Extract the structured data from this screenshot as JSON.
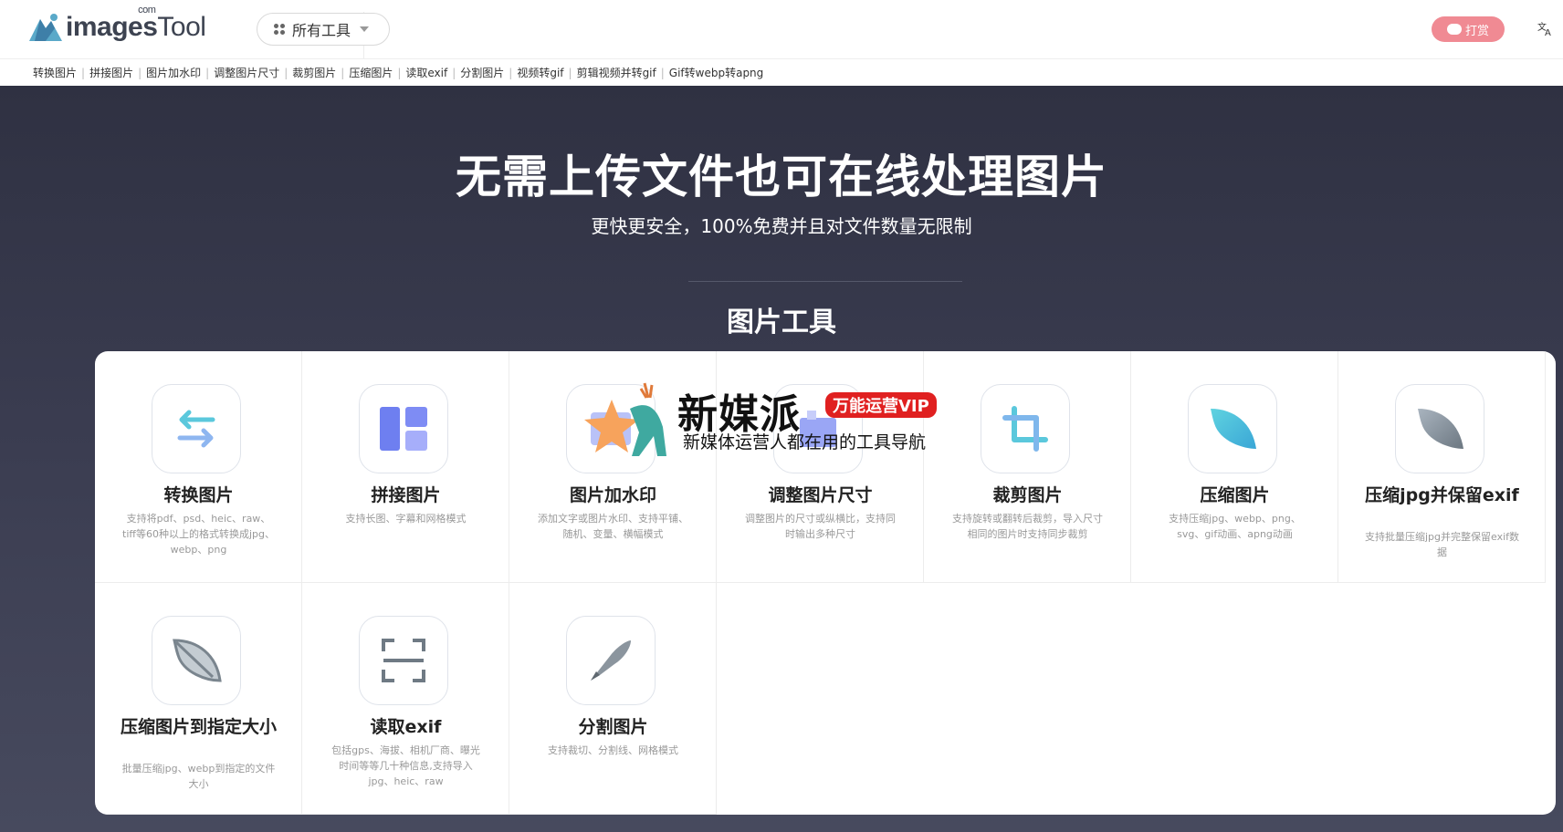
{
  "header": {
    "logo": {
      "main": "images",
      "tool": "Tool",
      "com": "com"
    },
    "tools_dropdown_label": "所有工具",
    "tip_button_label": "打赏",
    "language_icon": "translate-icon"
  },
  "subnav": {
    "items": [
      "转换图片",
      "拼接图片",
      "图片加水印",
      "调整图片尺寸",
      "裁剪图片",
      "压缩图片",
      "读取exif",
      "分割图片",
      "视频转gif",
      "剪辑视频并转gif",
      "Gif转webp转apng"
    ]
  },
  "hero": {
    "title": "无需上传文件也可在线处理图片",
    "subtitle": "更快更安全，100%免费并且对文件数量无限制",
    "section_title": "图片工具"
  },
  "tools": [
    {
      "name": "转换图片",
      "desc": "支持将pdf、psd、heic、raw、tiff等60种以上的格式转换成jpg、webp、png",
      "icon": "convert-arrows-icon"
    },
    {
      "name": "拼接图片",
      "desc": "支持长图、字幕和网格模式",
      "icon": "collage-icon"
    },
    {
      "name": "图片加水印",
      "desc": "添加文字或图片水印、支持平铺、随机、变量、横幅模式",
      "icon": "watermark-icon"
    },
    {
      "name": "调整图片尺寸",
      "desc": "调整图片的尺寸或纵横比，支持同时输出多种尺寸",
      "icon": "resize-icon"
    },
    {
      "name": "裁剪图片",
      "desc": "支持旋转或翻转后裁剪，导入尺寸相同的图片时支持同步裁剪",
      "icon": "crop-icon"
    },
    {
      "name": "压缩图片",
      "desc": "支持压缩jpg、webp、png、svg、gif动画、apng动画",
      "icon": "leaf-icon"
    },
    {
      "name": "压缩jpg并保留exif",
      "desc": "支持批量压缩jpg并完整保留exif数据",
      "icon": "leaf-gray-icon"
    },
    {
      "name": "压缩图片到指定大小",
      "desc": "批量压缩jpg、webp到指定的文件大小",
      "icon": "leaf-outline-icon"
    },
    {
      "name": "读取exif",
      "desc": "包括gps、海拔、相机厂商、曝光时间等等几十种信息,支持导入jpg、heic、raw",
      "icon": "scan-icon"
    },
    {
      "name": "分割图片",
      "desc": "支持裁切、分割线、网格模式",
      "icon": "knife-icon"
    }
  ],
  "watermark": {
    "title": "新媒派",
    "badge": "万能运营VIP",
    "subtitle": "新媒体运营人都在用的工具导航"
  },
  "colors": {
    "hero_bg": "#2f3142",
    "tip_button": "#f08a93",
    "accent_teal": "#5bc8dc",
    "accent_purple": "#8b7cf6"
  }
}
